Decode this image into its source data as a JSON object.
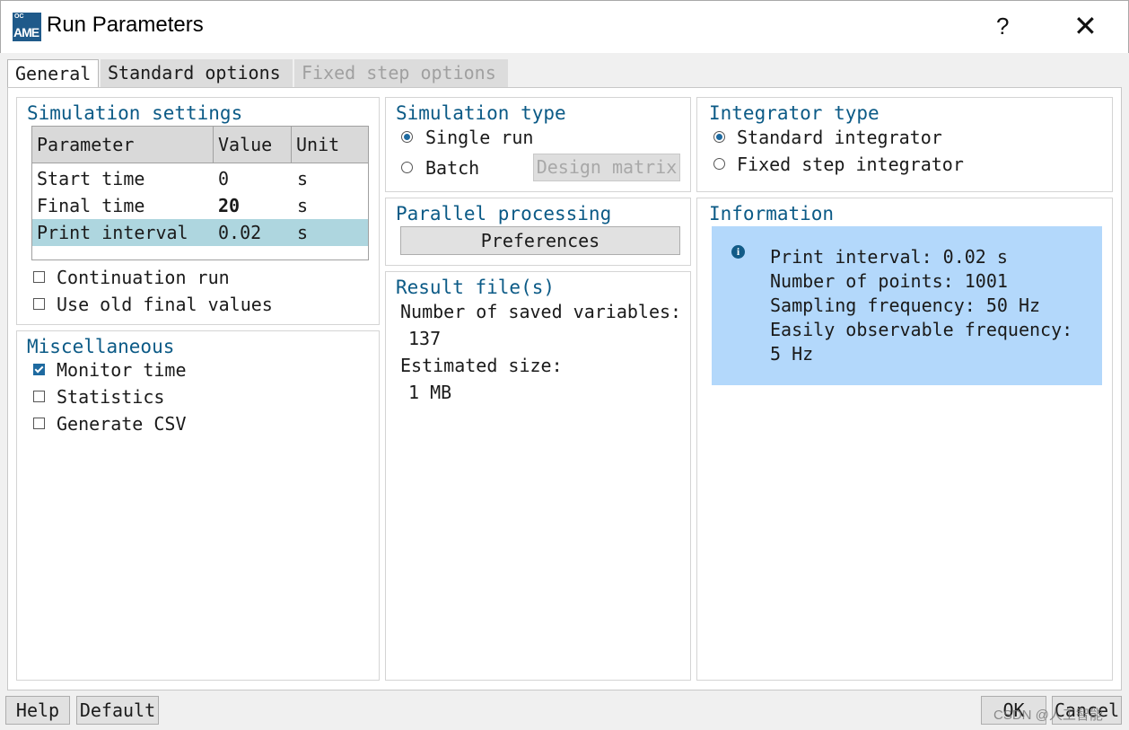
{
  "window": {
    "title": "Run Parameters",
    "logo_small": "OC",
    "logo_text": "AME",
    "help_glyph": "?",
    "close_glyph": "✕"
  },
  "tabs": [
    "General",
    "Standard options",
    "Fixed step options"
  ],
  "simulation_settings": {
    "title": "Simulation settings",
    "columns": [
      "Parameter",
      "Value",
      "Unit"
    ],
    "rows": [
      {
        "param": "Start time",
        "value": "0",
        "unit": "s"
      },
      {
        "param": "Final time",
        "value": "20",
        "unit": "s"
      },
      {
        "param": "Print interval",
        "value": "0.02",
        "unit": "s"
      }
    ],
    "continuation_run": {
      "label": "Continuation run",
      "checked": false
    },
    "use_old_final_values": {
      "label": "Use old final values",
      "checked": false
    }
  },
  "miscellaneous": {
    "title": "Miscellaneous",
    "monitor_time": {
      "label": "Monitor time",
      "checked": true
    },
    "statistics": {
      "label": "Statistics",
      "checked": false
    },
    "generate_csv": {
      "label": "Generate CSV",
      "checked": false
    }
  },
  "simulation_type": {
    "title": "Simulation type",
    "single_run": {
      "label": "Single run",
      "selected": true
    },
    "batch": {
      "label": "Batch",
      "selected": false
    },
    "design_matrix_label": "Design matrix"
  },
  "parallel_processing": {
    "title": "Parallel processing",
    "preferences_label": "Preferences"
  },
  "result_files": {
    "title": "Result file(s)",
    "saved_variables_label": "Number of saved variables:",
    "saved_variables_value": "137",
    "estimated_size_label": "Estimated size:",
    "estimated_size_value": "1 MB"
  },
  "integrator_type": {
    "title": "Integrator type",
    "standard": {
      "label": "Standard integrator",
      "selected": true
    },
    "fixed_step": {
      "label": "Fixed step integrator",
      "selected": false
    }
  },
  "information": {
    "title": "Information",
    "icon_glyph": "i",
    "lines": [
      "Print interval: 0.02 s",
      "Number of points: 1001",
      "Sampling frequency: 50 Hz",
      "Easily observable frequency:",
      "5 Hz"
    ]
  },
  "footer": {
    "help_label": "Help",
    "default_label": "Default",
    "ok_label": "OK",
    "cancel_label": "Cancel"
  },
  "watermark": "CSDN @人工智能",
  "colors": {
    "section_title": "#0b5a86",
    "info_background": "#b3d8fb",
    "selected_row": "#aed6df",
    "accent": "#1e6aa0"
  }
}
